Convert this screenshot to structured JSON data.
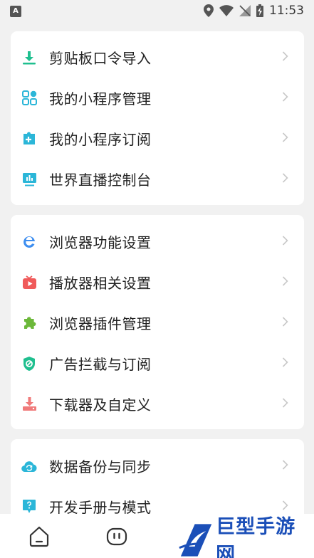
{
  "status_bar": {
    "app_badge": "A",
    "time": "11:53"
  },
  "groups": [
    {
      "items": [
        {
          "label": "剪贴板口令导入",
          "icon": "download-icon",
          "color": "#1fbf8f"
        },
        {
          "label": "我的小程序管理",
          "icon": "grid-icon",
          "color": "#2bb6d8"
        },
        {
          "label": "我的小程序订阅",
          "icon": "puzzle-plus-icon",
          "color": "#2bb6d8"
        },
        {
          "label": "世界直播控制台",
          "icon": "monitor-icon",
          "color": "#2bb6d8"
        }
      ]
    },
    {
      "items": [
        {
          "label": "浏览器功能设置",
          "icon": "browser-e-icon",
          "color": "#3d8ef0"
        },
        {
          "label": "播放器相关设置",
          "icon": "tv-play-icon",
          "color": "#f05a5a"
        },
        {
          "label": "浏览器插件管理",
          "icon": "puzzle-icon",
          "color": "#6cb83a"
        },
        {
          "label": "广告拦截与订阅",
          "icon": "shield-block-icon",
          "color": "#1fbf8f"
        },
        {
          "label": "下载器及自定义",
          "icon": "download-tray-icon",
          "color": "#f07a7a"
        }
      ]
    },
    {
      "items": [
        {
          "label": "数据备份与同步",
          "icon": "cloud-sync-icon",
          "color": "#2bb6d8"
        },
        {
          "label": "开发手册与模式",
          "icon": "help-bubble-icon",
          "color": "#2bb6d8"
        }
      ]
    }
  ],
  "watermark": {
    "text": "巨型手游网"
  }
}
